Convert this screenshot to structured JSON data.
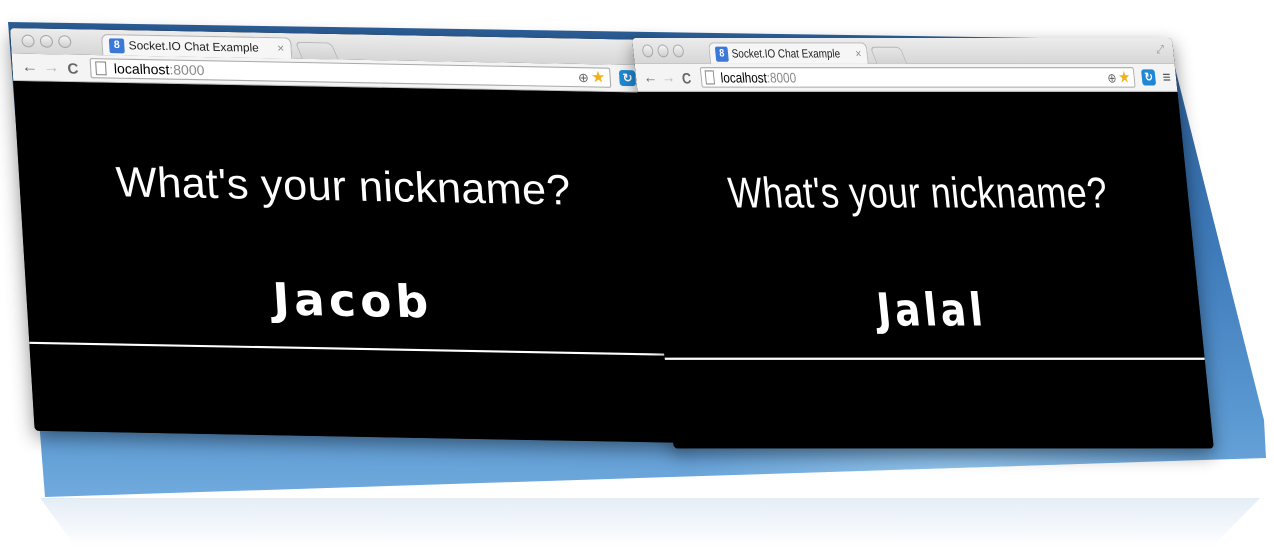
{
  "colors": {
    "desktop": "#3e7ab9",
    "page_background": "#000000",
    "page_text": "#ffffff"
  },
  "windows": [
    {
      "tab": {
        "title": "Socket.IO Chat Example",
        "favicon": "8",
        "close": "×"
      },
      "toolbar": {
        "back": "←",
        "forward": "→",
        "reload": "C",
        "url_host": "localhost",
        "url_port": ":8000",
        "zoom_icon": "⊕",
        "star_icon": "★",
        "extension_icon": "↻",
        "menu_icon": "≡"
      },
      "page": {
        "question": "What's your nickname?",
        "nickname": "Jacob"
      }
    },
    {
      "tab": {
        "title": "Socket.IO Chat Example",
        "favicon": "8",
        "close": "×"
      },
      "toolbar": {
        "back": "←",
        "forward": "→",
        "reload": "C",
        "url_host": "localhost",
        "url_port": ":8000",
        "zoom_icon": "⊕",
        "star_icon": "★",
        "extension_icon": "↻",
        "menu_icon": "≡"
      },
      "page": {
        "question": "What's your nickname?",
        "nickname": "Jalal"
      }
    }
  ]
}
